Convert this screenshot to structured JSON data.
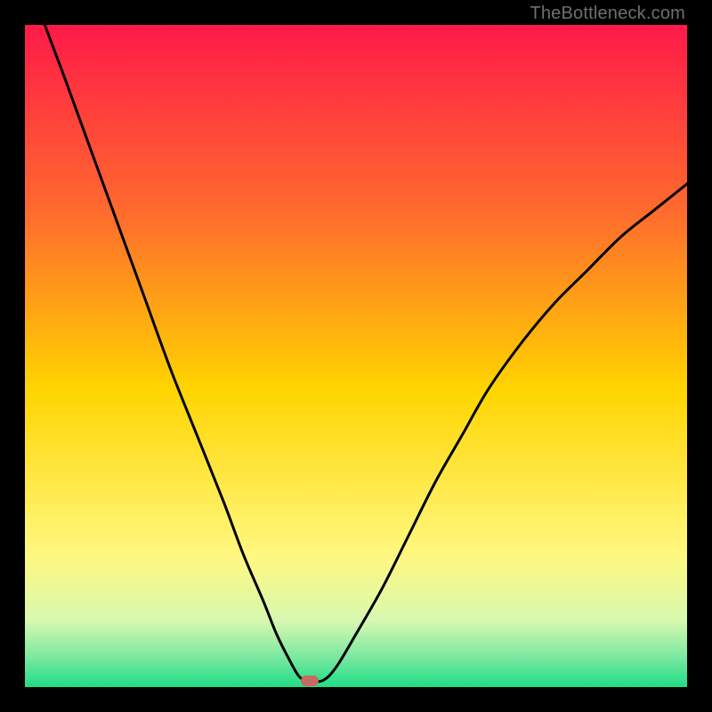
{
  "watermark": "TheBottleneck.com",
  "colors": {
    "frame": "#000000",
    "gradient_top": "#ff1a49",
    "gradient_mid_upper": "#ff7a2e",
    "gradient_mid": "#ffd400",
    "gradient_lower": "#fff8a0",
    "gradient_green1": "#9ef0b0",
    "gradient_green2": "#1fdd85",
    "curve": "#000000",
    "marker": "#c76a61"
  },
  "chart_data": {
    "type": "line",
    "title": "",
    "xlabel": "",
    "ylabel": "",
    "xlim": [
      0,
      100
    ],
    "ylim": [
      0,
      100
    ],
    "series": [
      {
        "name": "bottleneck-curve",
        "x": [
          3,
          6,
          10,
          14,
          18,
          22,
          26,
          30,
          33,
          36,
          38,
          40,
          41.5,
          43,
          45,
          47,
          50,
          54,
          58,
          62,
          66,
          70,
          75,
          80,
          85,
          90,
          95,
          100
        ],
        "y": [
          100,
          92,
          81,
          70,
          59,
          48,
          38,
          28,
          20,
          13,
          8,
          4,
          1.5,
          1,
          1,
          3,
          8,
          15,
          23,
          31,
          38,
          45,
          52,
          58,
          63,
          68,
          72,
          76
        ]
      }
    ],
    "flat_segment": {
      "x_start": 41.5,
      "x_end": 45,
      "y": 1
    },
    "marker": {
      "x": 43,
      "y": 1
    },
    "gradient_stops": [
      {
        "pos": 0.0,
        "color": "#ff1a49"
      },
      {
        "pos": 0.28,
        "color": "#ff6a2e"
      },
      {
        "pos": 0.55,
        "color": "#ffd400"
      },
      {
        "pos": 0.8,
        "color": "#fff880"
      },
      {
        "pos": 0.9,
        "color": "#d8f8b0"
      },
      {
        "pos": 0.955,
        "color": "#7ae8a0"
      },
      {
        "pos": 1.0,
        "color": "#1fdd85"
      }
    ]
  }
}
